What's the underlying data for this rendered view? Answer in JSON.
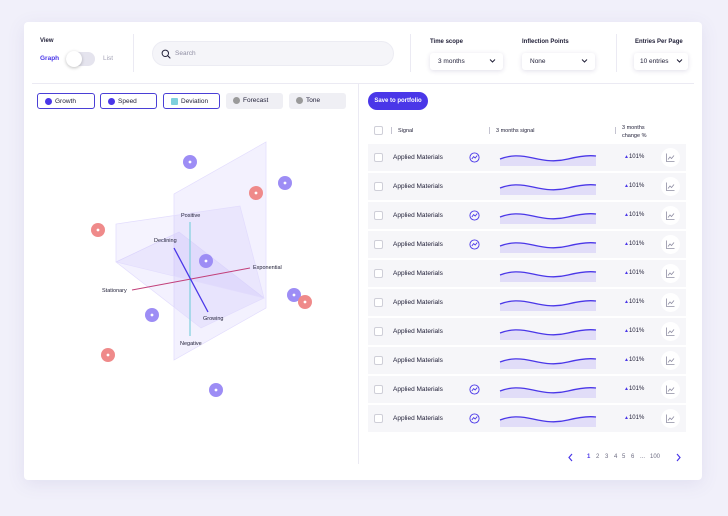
{
  "view": {
    "label": "View",
    "option_graph": "Graph",
    "option_list": "List"
  },
  "search": {
    "placeholder": "Search"
  },
  "time_scope": {
    "label": "Time scope",
    "value": "3 months"
  },
  "inflection_points": {
    "label": "Inflection Points",
    "value": "None"
  },
  "entries_per_page": {
    "label": "Entries Per Page",
    "value": "10 entries"
  },
  "filters": [
    {
      "label": "Growth",
      "color": "#4a37e8",
      "active": true
    },
    {
      "label": "Speed",
      "color": "#4a37e8",
      "active": true
    },
    {
      "label": "Deviation",
      "color": "#7fd0dd",
      "active": true
    },
    {
      "label": "Forecast",
      "color": "#9a9a9a",
      "active": false
    },
    {
      "label": "Tone",
      "color": "#9a9a9a",
      "active": false
    }
  ],
  "graph": {
    "labels": {
      "positive": "Positive",
      "negative": "Negative",
      "declining": "Declining",
      "growing": "Growing",
      "stationary": "Stationary",
      "exponential": "Exponential"
    },
    "colors": {
      "purple": "#9d8df5",
      "red": "#ef8a8a",
      "plane": "#d9d3fb"
    }
  },
  "save_button": "Save to portfolio",
  "table": {
    "headers": {
      "signal": "Signal",
      "three_months_signal": "3 months signal",
      "change": "3 months change %"
    },
    "rows": [
      {
        "name": "Applied Materials",
        "badge": true,
        "change": "101%"
      },
      {
        "name": "Applied Materials",
        "badge": false,
        "change": "101%"
      },
      {
        "name": "Applied Materials",
        "badge": true,
        "change": "101%"
      },
      {
        "name": "Applied Materials",
        "badge": true,
        "change": "101%"
      },
      {
        "name": "Applied Materials",
        "badge": false,
        "change": "101%"
      },
      {
        "name": "Applied Materials",
        "badge": false,
        "change": "101%"
      },
      {
        "name": "Applied Materials",
        "badge": false,
        "change": "101%"
      },
      {
        "name": "Applied Materials",
        "badge": false,
        "change": "101%"
      },
      {
        "name": "Applied Materials",
        "badge": true,
        "change": "101%"
      },
      {
        "name": "Applied Materials",
        "badge": true,
        "change": "101%"
      }
    ]
  },
  "pagination": {
    "pages": [
      "1",
      "2",
      "3",
      "4",
      "5",
      "6",
      "...",
      "100"
    ],
    "current": "1"
  },
  "colors": {
    "accent": "#4a37e8",
    "background": "#f1f0fa"
  }
}
